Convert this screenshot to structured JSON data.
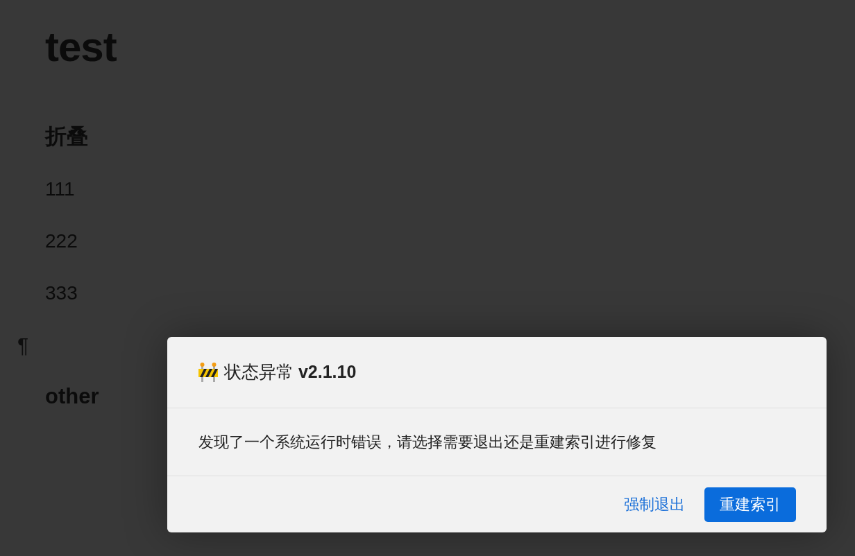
{
  "document": {
    "title": "test",
    "blocks": [
      {
        "kind": "heading",
        "text": "折叠"
      },
      {
        "kind": "paragraph",
        "text": "111"
      },
      {
        "kind": "paragraph",
        "text": "222"
      },
      {
        "kind": "paragraph",
        "text": "333"
      },
      {
        "kind": "empty",
        "text": "¶"
      },
      {
        "kind": "heading",
        "text": "other"
      }
    ]
  },
  "dialog": {
    "title": "状态异常 **v2.1.10**",
    "message": "发现了一个系统运行时错误，请选择需要退出还是重建索引进行修复",
    "buttons": [
      {
        "label": "强制退出",
        "kind": "link"
      },
      {
        "label": "重建索引",
        "kind": "primary"
      }
    ]
  }
}
